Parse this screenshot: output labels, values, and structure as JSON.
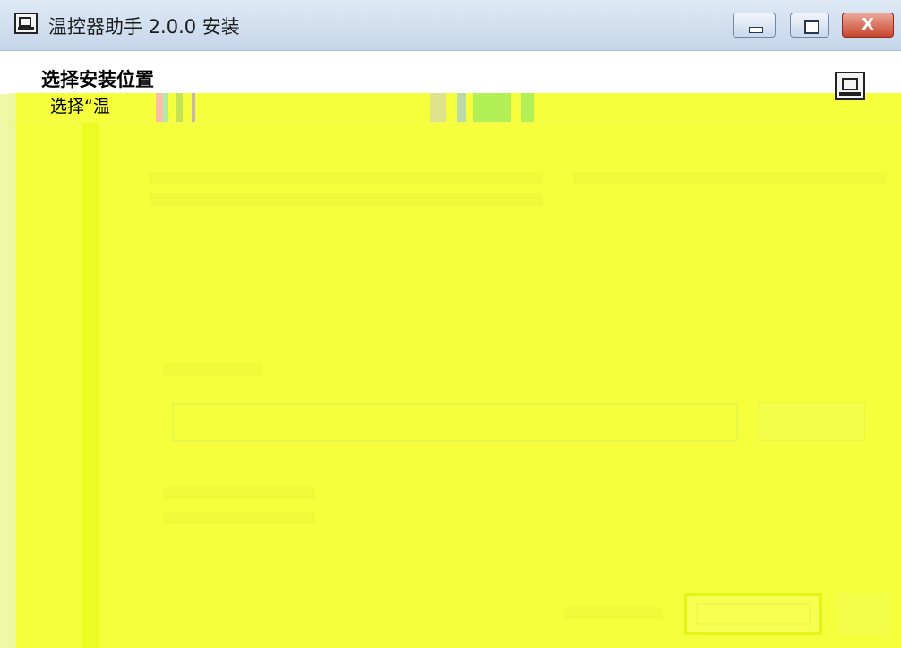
{
  "window": {
    "title": "温控器助手 2.0.0 安装",
    "icon": "installer-app-icon",
    "controls": {
      "minimize": "minimize-icon",
      "maximize": "maximize-icon",
      "close": "close-icon",
      "close_glyph": "X"
    }
  },
  "header": {
    "heading": "选择安装位置",
    "subheading": "选择“温",
    "logo": "installer-logo-icon"
  },
  "colors": {
    "overlay": "#f6ff3c",
    "titlebar": "#c5d6ea",
    "close_button": "#c8452d"
  }
}
